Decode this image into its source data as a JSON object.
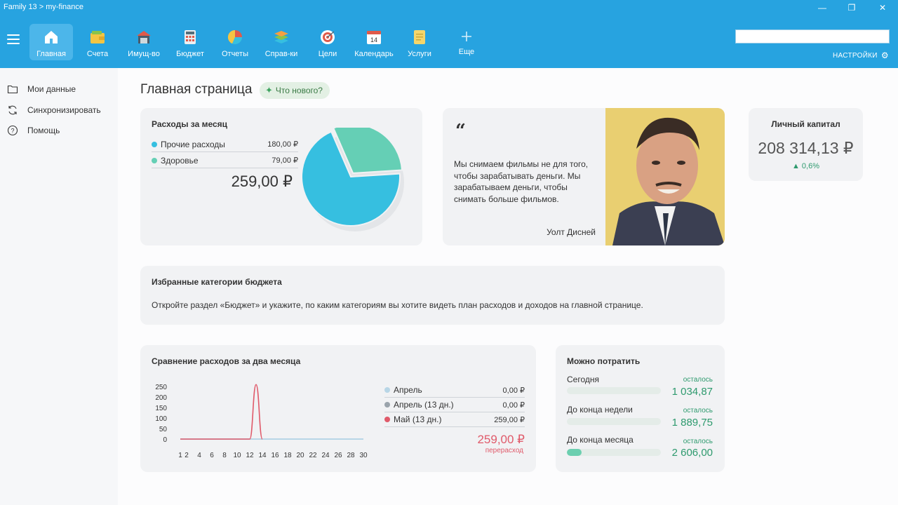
{
  "window": {
    "title": "Family 13 > my-finance",
    "minimize": "—",
    "restore": "❐",
    "close": "✕"
  },
  "nav": {
    "items": [
      {
        "label": "Главная",
        "icon": "home-icon",
        "active": true
      },
      {
        "label": "Счета",
        "icon": "wallet-icon"
      },
      {
        "label": "Имущ-во",
        "icon": "property-icon"
      },
      {
        "label": "Бюджет",
        "icon": "calculator-icon"
      },
      {
        "label": "Отчеты",
        "icon": "pie-chart-icon"
      },
      {
        "label": "Справ-ки",
        "icon": "layers-icon"
      },
      {
        "label": "Цели",
        "icon": "target-icon"
      },
      {
        "label": "Календарь",
        "icon": "calendar-icon",
        "badge": "14"
      },
      {
        "label": "Услуги",
        "icon": "document-icon"
      },
      {
        "label": "Еще",
        "icon": "plus-icon"
      }
    ],
    "settings_label": "НАСТРОЙКИ",
    "search_value": ""
  },
  "sidebar": {
    "items": [
      {
        "label": "Мои данные",
        "icon": "folder-icon"
      },
      {
        "label": "Синхронизировать",
        "icon": "sync-icon"
      },
      {
        "label": "Помощь",
        "icon": "help-icon"
      }
    ]
  },
  "main": {
    "title": "Главная страница",
    "whats_new": "Что нового?"
  },
  "expenses": {
    "title": "Расходы за месяц",
    "rows": [
      {
        "label": "Прочие расходы",
        "value": "180,00 ₽",
        "amount": 180,
        "color": "#36bfe0"
      },
      {
        "label": "Здоровье",
        "value": "79,00 ₽",
        "amount": 79,
        "color": "#65cfb5"
      }
    ],
    "total": "259,00 ₽"
  },
  "quote": {
    "mark": "“",
    "text": "Мы снимаем фильмы не для того, чтобы зарабатывать деньги. Мы зарабатываем деньги, чтобы снимать больше фильмов.",
    "author": "Уолт Дисней"
  },
  "capital": {
    "title": "Личный капитал",
    "value": "208 314,13 ₽",
    "change": "▲ 0,6%"
  },
  "favorites": {
    "title": "Избранные категории бюджета",
    "text": "Откройте раздел «Бюджет» и укажите, по каким категориям вы хотите видеть план расходов и доходов на главной странице."
  },
  "comparison": {
    "title": "Сравнение расходов за два месяца",
    "legend": [
      {
        "label": "Апрель",
        "value": "0,00 ₽",
        "color": "#b8d6e6"
      },
      {
        "label": "Апрель (13 дн.)",
        "value": "0,00 ₽",
        "color": "#9aa3ab"
      },
      {
        "label": "Май (13 дн.)",
        "value": "259,00 ₽",
        "color": "#e05a6a"
      }
    ],
    "overspend_value": "259,00 ₽",
    "overspend_label": "перерасход"
  },
  "spend": {
    "title": "Можно потратить",
    "rows": [
      {
        "label": "Сегодня",
        "left_label": "осталось",
        "value": "1 034,87",
        "fill": 0
      },
      {
        "label": "До конца недели",
        "left_label": "осталось",
        "value": "1 889,75",
        "fill": 0
      },
      {
        "label": "До конца месяца",
        "left_label": "осталось",
        "value": "2 606,00",
        "fill": 0.16
      }
    ]
  },
  "chart_data": {
    "type": "line",
    "x": [
      1,
      2,
      3,
      4,
      5,
      6,
      7,
      8,
      9,
      10,
      11,
      12,
      13,
      14,
      15,
      16,
      17,
      18,
      19,
      20,
      21,
      22,
      23,
      24,
      25,
      26,
      27,
      28,
      29,
      30
    ],
    "xticks": [
      "1",
      "2",
      "4",
      "6",
      "8",
      "10",
      "12",
      "14",
      "16",
      "18",
      "20",
      "22",
      "24",
      "26",
      "28",
      "30"
    ],
    "yticks": [
      0,
      50,
      100,
      150,
      200,
      250
    ],
    "ylim": [
      0,
      250
    ],
    "xlim": [
      1,
      30
    ],
    "series": [
      {
        "name": "Май (13 дн.)",
        "color": "#e05a6a",
        "x": [
          1,
          2,
          3,
          4,
          5,
          6,
          7,
          8,
          9,
          10,
          11,
          12,
          13,
          14
        ],
        "values": [
          0,
          0,
          0,
          0,
          0,
          0,
          0,
          0,
          0,
          0,
          0,
          0,
          259,
          0
        ]
      },
      {
        "name": "Апрель",
        "color": "#b8d6e6",
        "x": [
          1,
          30
        ],
        "values": [
          0,
          0
        ]
      }
    ]
  }
}
